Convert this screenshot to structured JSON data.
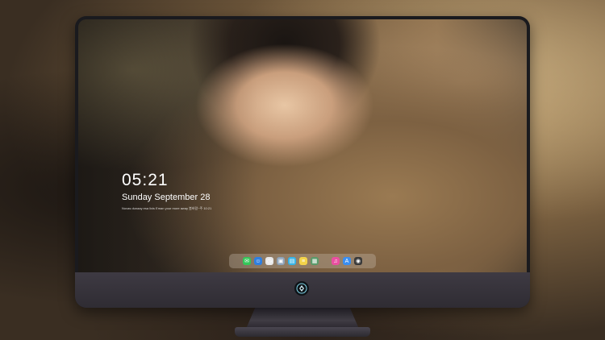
{
  "lockscreen": {
    "time": "05:21",
    "date": "Sunday September  28",
    "quote": "Novas dunaay esa lixis Eman your more away 봄바람~주 10:21"
  },
  "dock": {
    "items": [
      {
        "name": "messages-icon",
        "glyph": "✉",
        "color": "#34c759"
      },
      {
        "name": "finder-icon",
        "glyph": "☺",
        "color": "#2f7fe0"
      },
      {
        "name": "clock-icon",
        "glyph": "◷",
        "color": "#e8e8e8"
      },
      {
        "name": "preview-icon",
        "glyph": "▣",
        "color": "#8fa3b8"
      },
      {
        "name": "files-icon",
        "glyph": "▤",
        "color": "#36b3e6"
      },
      {
        "name": "notes-icon",
        "glyph": "≡",
        "color": "#f3d34a"
      },
      {
        "name": "photos-icon",
        "glyph": "▦",
        "color": "#5a9a6a"
      },
      {
        "name": "music-icon",
        "glyph": "♫",
        "color": "#e94fa0"
      },
      {
        "name": "app-store-icon",
        "glyph": "A",
        "color": "#3a8ef0"
      },
      {
        "name": "camera-icon",
        "glyph": "◉",
        "color": "#3a3a3a"
      }
    ]
  },
  "colors": {
    "monitor_bezel": "#1a1a1e",
    "chin": "#3e3a43",
    "text": "#ffffff"
  }
}
